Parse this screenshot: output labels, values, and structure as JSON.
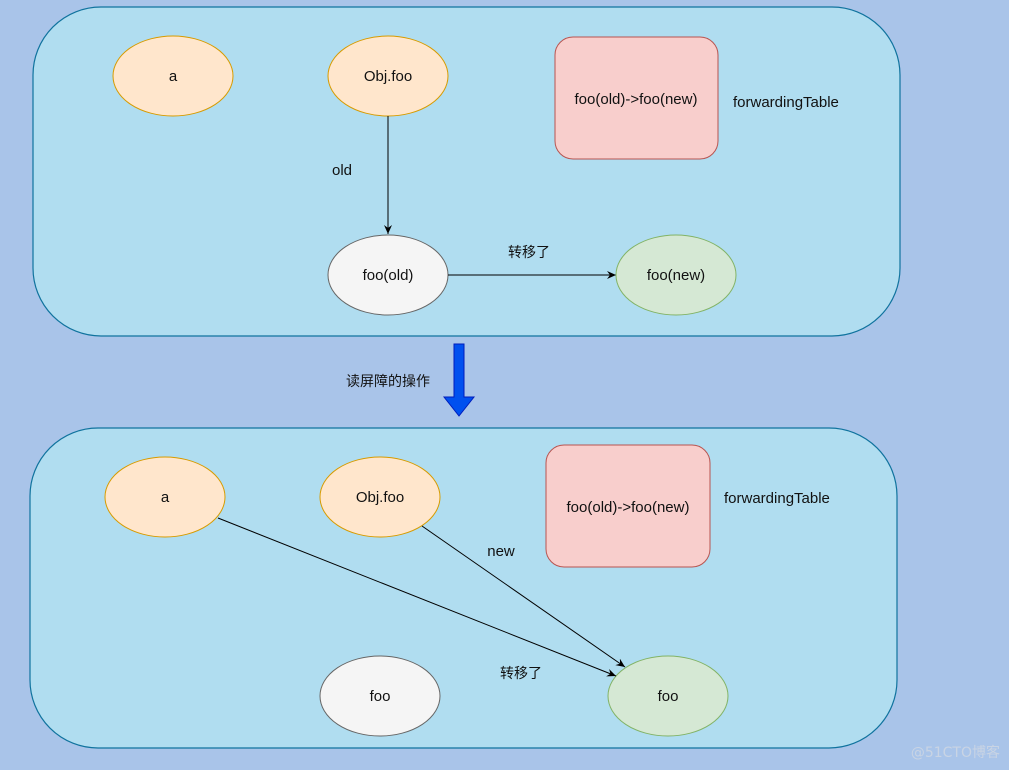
{
  "colors": {
    "background": "#a9c4e9",
    "panel_fill": "#b0ddf0",
    "panel_stroke": "#10739e",
    "ref_fill": "#ffe6cc",
    "ref_stroke": "#d79b00",
    "old_fill": "#f5f5f5",
    "old_stroke": "#666666",
    "new_fill": "#d5e8d4",
    "new_stroke": "#82b366",
    "table_fill": "#f8cecc",
    "table_stroke": "#b85450",
    "arrow_blue": "#0050ef"
  },
  "top_panel": {
    "nodes": {
      "a": "a",
      "obj_foo": "Obj.foo",
      "foo_old": "foo(old)",
      "foo_new": "foo(new)"
    },
    "forwarding_table": {
      "content": "foo(old)->foo(new)",
      "label": "forwardingTable"
    },
    "edges": {
      "obj_to_old_label": "old",
      "old_to_new_label": "转移了"
    }
  },
  "transition": {
    "label": "读屏障的操作"
  },
  "bottom_panel": {
    "nodes": {
      "a": "a",
      "obj_foo": "Obj.foo",
      "foo_old": "foo",
      "foo_new": "foo"
    },
    "forwarding_table": {
      "content": "foo(old)->foo(new)",
      "label": "forwardingTable"
    },
    "edges": {
      "obj_to_new_label": "new",
      "moved_label": "转移了"
    }
  },
  "watermark": "@51CTO博客"
}
